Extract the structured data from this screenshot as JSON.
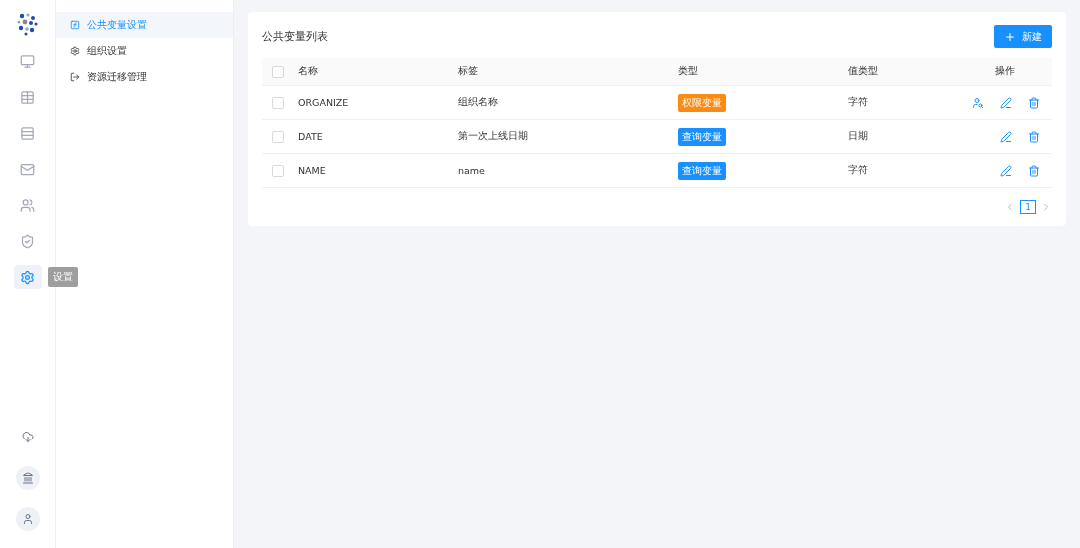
{
  "rail": {
    "items": [
      {
        "kind": "monitor",
        "selected": false
      },
      {
        "kind": "table",
        "selected": false
      },
      {
        "kind": "rows",
        "selected": false
      },
      {
        "kind": "mail",
        "selected": false
      },
      {
        "kind": "users",
        "selected": false
      },
      {
        "kind": "shield",
        "selected": false
      },
      {
        "kind": "settings",
        "selected": true
      }
    ],
    "tooltip": "设置",
    "bottom": [
      {
        "kind": "cloud"
      },
      {
        "kind": "bank"
      },
      {
        "kind": "user"
      }
    ]
  },
  "menu": [
    {
      "label": "公共变量设置",
      "kind": "function",
      "selected": true
    },
    {
      "label": "组织设置",
      "kind": "gear",
      "selected": false
    },
    {
      "label": "资源迁移管理",
      "kind": "exit",
      "selected": false
    }
  ],
  "card": {
    "title": "公共变量列表",
    "new_button": "新建",
    "columns": [
      "名称",
      "标签",
      "类型",
      "值类型",
      "操作"
    ],
    "header_checked": false,
    "rows": [
      {
        "checked": false,
        "name": "ORGANIZE",
        "label": "组织名称",
        "type": {
          "text": "权限变量",
          "color": "#fa8c16"
        },
        "value_type": "字符",
        "permission_action": true
      },
      {
        "checked": false,
        "name": "DATE",
        "label": "第一次上线日期",
        "type": {
          "text": "查询变量",
          "color": "#1890ff"
        },
        "value_type": "日期",
        "permission_action": false
      },
      {
        "checked": false,
        "name": "NAME",
        "label": "name",
        "type": {
          "text": "查询变量",
          "color": "#1890ff"
        },
        "value_type": "字符",
        "permission_action": false
      }
    ],
    "pagination": {
      "pages": [
        {
          "label": "1",
          "selected": true
        }
      ]
    }
  }
}
